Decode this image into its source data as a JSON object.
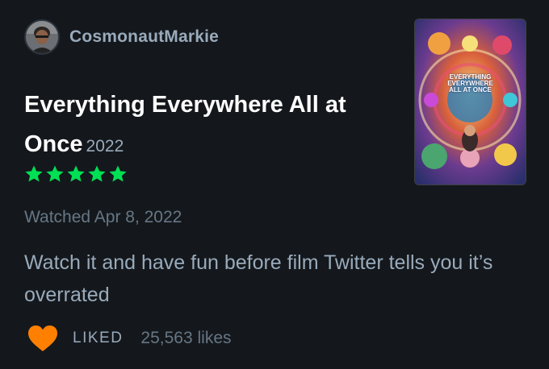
{
  "author": {
    "name": "CosmonautMarkie",
    "avatar_icon": "avatar-photo"
  },
  "film": {
    "title": "Everything Everywhere All at Once",
    "year": "2022",
    "poster": {
      "title_lines": [
        "EVERYTHING",
        "EVERYWHERE",
        "ALL AT ONCE"
      ]
    }
  },
  "rating": {
    "stars": 5,
    "max": 5,
    "star_color": "#00e054",
    "star_icon": "star-icon"
  },
  "watched": {
    "text": "Watched Apr 8, 2022"
  },
  "review": {
    "text": "Watch it and have fun before film Twitter tells you it’s overrated"
  },
  "footer": {
    "liked_label": "LIKED",
    "likes_count": "25,563 likes",
    "heart_icon": "heart-icon",
    "heart_color": "#ff8000"
  },
  "colors": {
    "background": "#14181c",
    "muted": "#99aabb",
    "dim": "#677685"
  }
}
